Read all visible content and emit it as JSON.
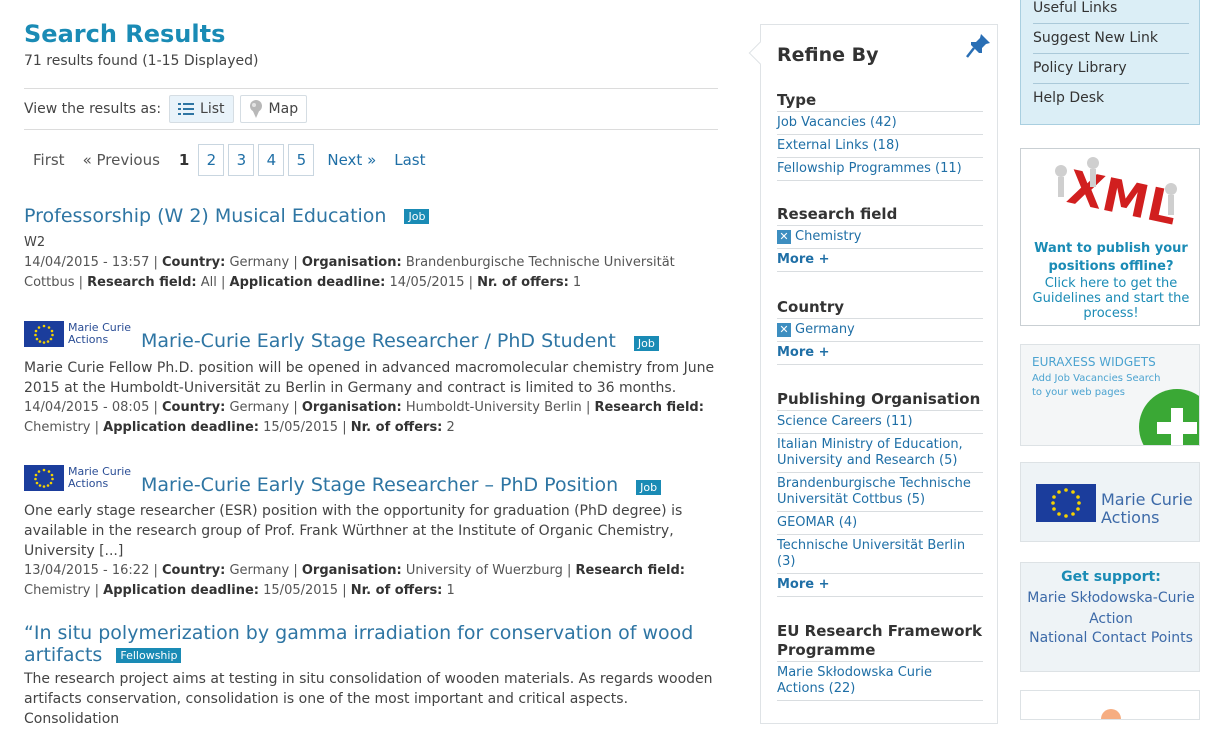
{
  "main": {
    "title": "Search Results",
    "results_count": "71 results found (1-15 Displayed)",
    "view_label": "View the results as:",
    "view_list": "List",
    "view_map": "Map",
    "pager": {
      "first": "First",
      "previous": "« Previous",
      "current": "1",
      "pages": [
        "2",
        "3",
        "4",
        "5"
      ],
      "next": "Next »",
      "last": "Last"
    },
    "results": [
      {
        "title": "Professorship (W 2) Musical Education",
        "badge": "Job",
        "subtitle": "W2",
        "date": "14/04/2015 - 13:57",
        "country_label": "Country:",
        "country": "Germany",
        "org_label": "Organisation:",
        "org": "Brandenburgische Technische Universität Cottbus",
        "field_label": "Research field:",
        "field": "All",
        "deadline_label": "Application deadline:",
        "deadline": "14/05/2015",
        "offers_label": "Nr. of offers:",
        "offers": "1"
      },
      {
        "logo_line1": "Marie Curie",
        "logo_line2": "Actions",
        "title": "Marie-Curie Early Stage Researcher / PhD Student",
        "badge": "Job",
        "body": "Marie Curie Fellow Ph.D. position will be opened in advanced macromolecular chemistry from June 2015 at the Humboldt-Universität zu Berlin in Germany and contract is limited to 36 months.",
        "date": "14/04/2015 - 08:05",
        "country_label": "Country:",
        "country": "Germany",
        "org_label": "Organisation:",
        "org": "Humboldt-University Berlin",
        "field_label": "Research field:",
        "field": "Chemistry",
        "deadline_label": "Application deadline:",
        "deadline": "15/05/2015",
        "offers_label": "Nr. of offers:",
        "offers": "2"
      },
      {
        "logo_line1": "Marie Curie",
        "logo_line2": "Actions",
        "title": "Marie-Curie Early Stage Researcher – PhD Position",
        "badge": "Job",
        "body": "One early stage researcher (ESR) position with the opportunity for graduation (PhD degree) is available in the research group of Prof. Frank Würthner at the Institute of Organic Chemistry, University [...]",
        "date": "13/04/2015 - 16:22",
        "country_label": "Country:",
        "country": "Germany",
        "org_label": "Organisation:",
        "org": "University of Wuerzburg",
        "field_label": "Research field:",
        "field": "Chemistry",
        "deadline_label": "Application deadline:",
        "deadline": "15/05/2015",
        "offers_label": "Nr. of offers:",
        "offers": "1"
      },
      {
        "title_line1": "“In situ polymerization by gamma irradiation for conservation of wood",
        "title_line2": "artifacts",
        "badge": "Fellowship",
        "body": "The research project aims at testing in situ consolidation of wooden materials. As regards wooden artifacts conservation, consolidation is one of the most important and critical aspects. Consolidation"
      }
    ]
  },
  "refine": {
    "title": "Refine By",
    "type_head": "Type",
    "type_items": [
      "Job Vacancies (42)",
      "External Links (18)",
      "Fellowship Programmes (11)"
    ],
    "field_head": "Research field",
    "field_selected": "Chemistry",
    "more": "More +",
    "country_head": "Country",
    "country_selected": "Germany",
    "org_head": "Publishing Organisation",
    "org_items": [
      "Science Careers (11)",
      "Italian Ministry of Education, University and Research (5)",
      "Brandenburgische Technische Universität Cottbus (5)",
      "GEOMAR (4)",
      "Technische Universität Berlin (3)"
    ],
    "fp_head": "EU Research Framework Programme",
    "fp_items": [
      "Marie Skłodowska Curie Actions (22)"
    ]
  },
  "sidebar": {
    "links": [
      "Useful Links",
      "Suggest New Link",
      "Policy Library",
      "Help Desk"
    ],
    "xml_logo": "XML",
    "xml_question": "Want to publish your positions offline?",
    "xml_cta": "Click here to get the Guidelines and start the process!",
    "widgets_title": "EURAXESS WIDGETS",
    "widgets_text": "Add Job Vacancies Search to your web pages",
    "mca_line1": "Marie Curie",
    "mca_line2": "Actions",
    "support_head": "Get support:",
    "support_line1": "Marie Skłodowska-Curie Action",
    "support_line2": "National Contact Points"
  },
  "colors": {
    "accent": "#1a8bb5",
    "link": "#1f6fa6",
    "sidebar_bg": "#dbeef6",
    "eu_blue": "#1b3d9c"
  },
  "icons": [
    "list-icon",
    "map-pin-icon",
    "pushpin-icon",
    "remove-filter-icon",
    "eu-flag-icon",
    "plus-icon"
  ]
}
